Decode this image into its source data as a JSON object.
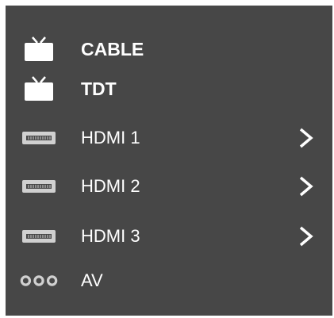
{
  "sources": [
    {
      "label": "CABLE",
      "icon": "tv-icon",
      "bold": true,
      "has_arrow": false
    },
    {
      "label": "TDT",
      "icon": "tv-icon",
      "bold": true,
      "has_arrow": false
    },
    {
      "label": "HDMI 1",
      "icon": "hdmi-port-icon",
      "bold": false,
      "has_arrow": true
    },
    {
      "label": "HDMI 2",
      "icon": "hdmi-port-icon",
      "bold": false,
      "has_arrow": true
    },
    {
      "label": "HDMI 3",
      "icon": "hdmi-port-icon",
      "bold": false,
      "has_arrow": true
    },
    {
      "label": "AV",
      "icon": "av-ports-icon",
      "bold": false,
      "has_arrow": false
    }
  ],
  "colors": {
    "panel_bg": "#474747",
    "text": "#ffffff",
    "icon": "#d0d0d0"
  }
}
